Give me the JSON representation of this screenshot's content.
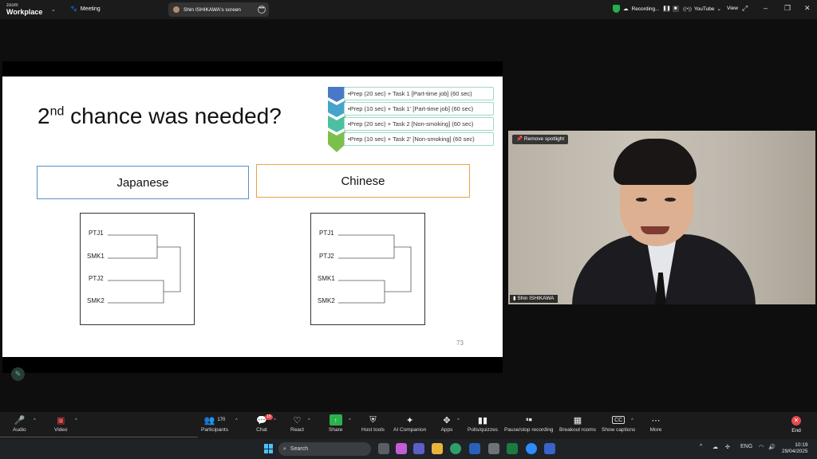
{
  "app": {
    "brand_top": "zoom",
    "brand_bottom": "Workplace",
    "meeting_label": "Meeting",
    "screen_share_label": "Shin ISHIKAWA's screen",
    "recording_label": "Recording...",
    "youtube_label": "YouTube",
    "view_label": "View"
  },
  "slide": {
    "title_main": "2",
    "title_sup": "nd",
    "title_rest": " chance was needed?",
    "steps": [
      "•Prep (20 sec) + Task 1 [Part-time job] (60 sec)",
      "•Prep (10 sec) + Task 1' [Part-time job] (60 sec)",
      "•Prep (20 sec) + Task 2 [Non-smoking] (60 sec)",
      "•Prep (10 sec) + Task 2' [Non-smoking] (60 sec)"
    ],
    "left_heading": "Japanese",
    "right_heading": "Chinese",
    "left_tree": [
      "PTJ1",
      "SMK1",
      "PTJ2",
      "SMK2"
    ],
    "right_tree": [
      "PTJ1",
      "PTJ2",
      "SMK1",
      "SMK2"
    ],
    "page_number": "73"
  },
  "video": {
    "spotlight_button": "Remove spotlight",
    "participant_name": "Shin ISHIKAWA"
  },
  "toolbar": {
    "audio": "Audio",
    "video": "Video",
    "participants": "Participants",
    "participants_count": "170",
    "chat": "Chat",
    "chat_badge": "15",
    "react": "React",
    "share": "Share",
    "host_tools": "Host tools",
    "ai_companion": "AI Companion",
    "apps": "Apps",
    "polls": "Polls/quizzes",
    "pause_recording": "Pause/stop recording",
    "breakout": "Breakout rooms",
    "captions": "Show captions",
    "more": "More",
    "end": "End"
  },
  "taskbar": {
    "search_placeholder": "Search",
    "language": "ENG",
    "time": "10:19",
    "date": "29/04/2025"
  },
  "colors": {
    "japanese_border": "#5b8fc9",
    "chinese_border": "#e8a24a",
    "step_arrow_top": "#4a78c9",
    "step_arrow_bottom": "#7cc04b",
    "end_red": "#e5484d",
    "shield_green": "#22b14c"
  }
}
